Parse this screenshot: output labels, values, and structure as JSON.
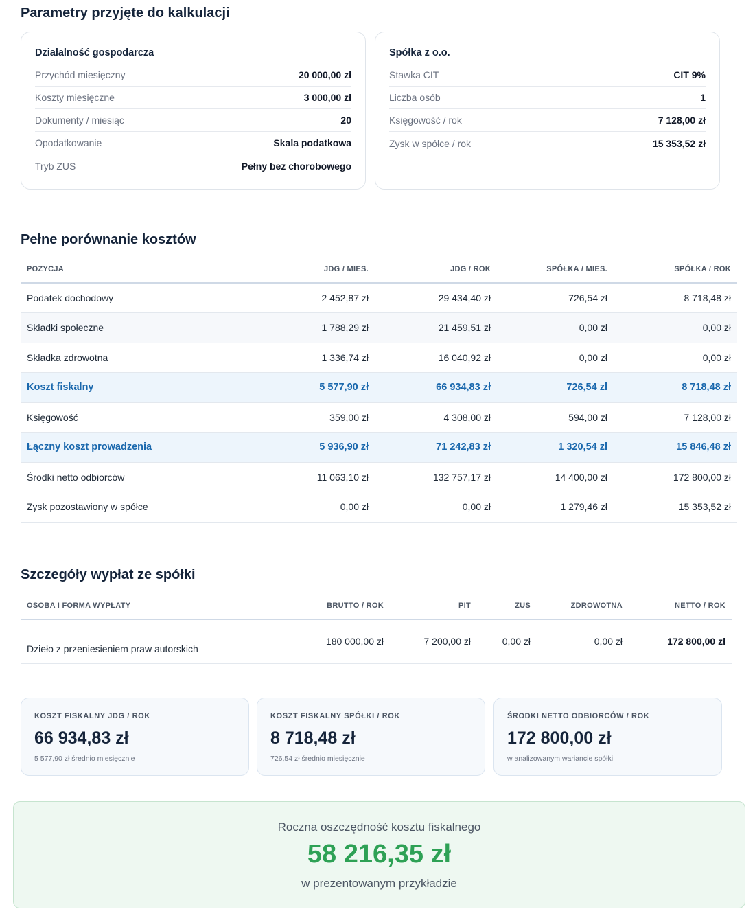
{
  "params": {
    "title": "Parametry przyjęte do kalkulacji",
    "jdg": {
      "title": "Działalność gospodarcza",
      "rows": [
        {
          "label": "Przychód miesięczny",
          "value": "20 000,00 zł"
        },
        {
          "label": "Koszty miesięczne",
          "value": "3 000,00 zł"
        },
        {
          "label": "Dokumenty / miesiąc",
          "value": "20"
        },
        {
          "label": "Opodatkowanie",
          "value": "Skala podatkowa"
        },
        {
          "label": "Tryb ZUS",
          "value": "Pełny bez chorobowego"
        }
      ]
    },
    "spolka": {
      "title": "Spółka z o.o.",
      "rows": [
        {
          "label": "Stawka CIT",
          "value": "CIT 9%"
        },
        {
          "label": "Liczba osób",
          "value": "1"
        },
        {
          "label": "Księgowość / rok",
          "value": "7 128,00 zł"
        },
        {
          "label": "Zysk w spółce / rok",
          "value": "15 353,52 zł"
        }
      ]
    }
  },
  "comparison": {
    "title": "Pełne porównanie kosztów",
    "headers": [
      "POZYCJA",
      "JDG / MIES.",
      "JDG / ROK",
      "SPÓŁKA / MIES.",
      "SPÓŁKA / ROK"
    ],
    "rows": [
      {
        "cells": [
          "Podatek dochodowy",
          "2 452,87 zł",
          "29 434,40 zł",
          "726,54 zł",
          "8 718,48 zł"
        ]
      },
      {
        "cells": [
          "Składki społeczne",
          "1 788,29 zł",
          "21 459,51 zł",
          "0,00 zł",
          "0,00 zł"
        ]
      },
      {
        "cells": [
          "Składka zdrowotna",
          "1 336,74 zł",
          "16 040,92 zł",
          "0,00 zł",
          "0,00 zł"
        ]
      },
      {
        "cells": [
          "Koszt fiskalny",
          "5 577,90 zł",
          "66 934,83 zł",
          "726,54 zł",
          "8 718,48 zł"
        ]
      },
      {
        "cells": [
          "Księgowość",
          "359,00 zł",
          "4 308,00 zł",
          "594,00 zł",
          "7 128,00 zł"
        ]
      },
      {
        "cells": [
          "Łączny koszt prowadzenia",
          "5 936,90 zł",
          "71 242,83 zł",
          "1 320,54 zł",
          "15 846,48 zł"
        ]
      },
      {
        "cells": [
          "Środki netto odbiorców",
          "11 063,10 zł",
          "132 757,17 zł",
          "14 400,00 zł",
          "172 800,00 zł"
        ]
      },
      {
        "cells": [
          "Zysk pozostawiony w spółce",
          "0,00 zł",
          "0,00 zł",
          "1 279,46 zł",
          "15 353,52 zł"
        ]
      }
    ]
  },
  "payouts": {
    "title": "Szczegóły wypłat ze spółki",
    "headers": [
      "OSOBA I FORMA WYPŁATY",
      "BRUTTO / ROK",
      "PIT",
      "ZUS",
      "ZDROWOTNA",
      "NETTO / ROK"
    ],
    "rows": [
      {
        "cells": [
          "Dzieło z przeniesieniem praw autorskich",
          "180 000,00 zł",
          "7 200,00 zł",
          "0,00 zł",
          "0,00 zł",
          "172 800,00 zł"
        ]
      }
    ]
  },
  "summary": [
    {
      "label": "KOSZT FISKALNY JDG / ROK",
      "value": "66 934,83 zł",
      "sub": "5 577,90 zł średnio miesięcznie"
    },
    {
      "label": "KOSZT FISKALNY SPÓŁKI / ROK",
      "value": "8 718,48 zł",
      "sub": "726,54 zł średnio miesięcznie"
    },
    {
      "label": "ŚRODKI NETTO ODBIORCÓW / ROK",
      "value": "172 800,00 zł",
      "sub": "w analizowanym wariancie spółki"
    }
  ],
  "savings": {
    "title": "Roczna oszczędność kosztu fiskalnego",
    "value": "58 216,35 zł",
    "sub": "w prezentowanym przykładzie"
  }
}
